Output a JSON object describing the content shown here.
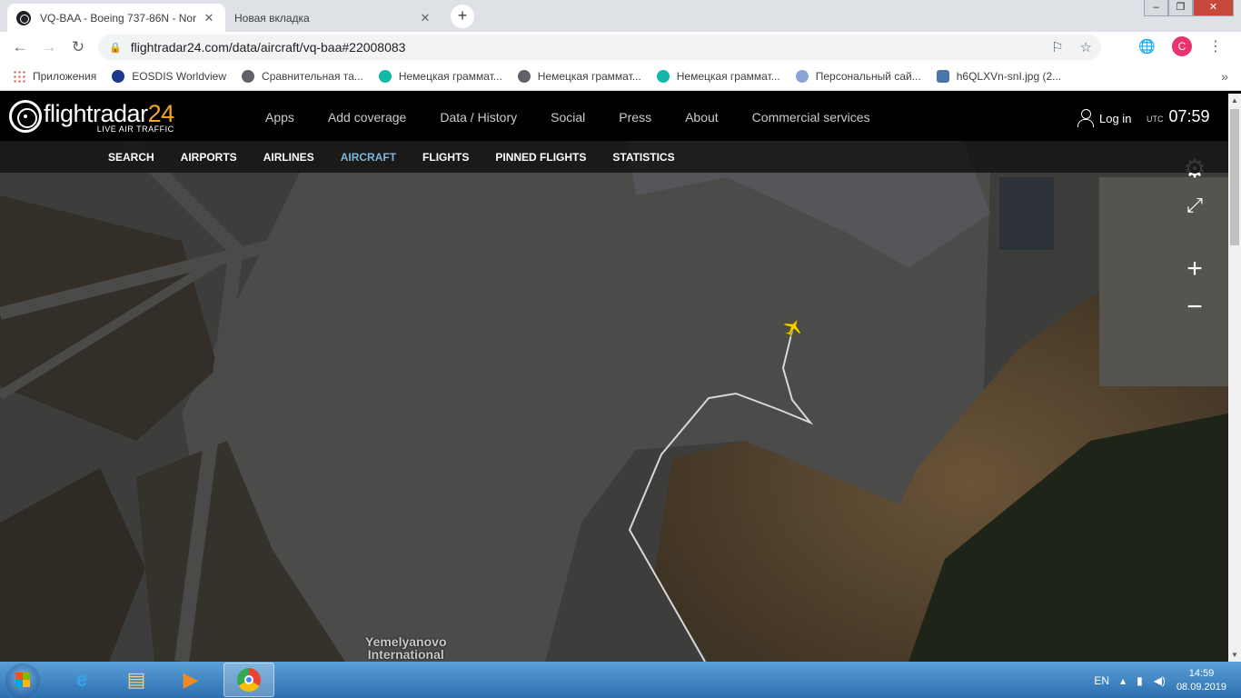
{
  "browser": {
    "tabs": [
      {
        "title": "VQ-BAA - Boeing 737-86N - Nor",
        "close": "✕"
      },
      {
        "title": "Новая вкладка",
        "close": "✕"
      }
    ],
    "new_tab": "+",
    "url": "flightradar24.com/data/aircraft/vq-baa#22008083",
    "profile_initial": "C",
    "bookmarks": [
      {
        "label": "Приложения",
        "icon_color": "apps"
      },
      {
        "label": "EOSDIS Worldview",
        "icon_color": "#1b3a8c"
      },
      {
        "label": "Сравнительная та...",
        "icon_color": "#5f6368"
      },
      {
        "label": "Немецкая граммат...",
        "icon_color": "#14b8a6"
      },
      {
        "label": "Немецкая граммат...",
        "icon_color": "#5f6368"
      },
      {
        "label": "Немецкая граммат...",
        "icon_color": "#14b8a6"
      },
      {
        "label": "Персональный сай...",
        "icon_color": "#8aa4d8"
      },
      {
        "label": "h6QLXVn-snI.jpg (2...",
        "icon_color": "#4a76a8"
      }
    ]
  },
  "fr24": {
    "logo_main": "flightradar",
    "logo_num": "24",
    "logo_sub": "LIVE AIR TRAFFIC",
    "nav": [
      "Apps",
      "Add coverage",
      "Data / History",
      "Social",
      "Press",
      "About",
      "Commercial services"
    ],
    "login": "Log in",
    "utc_label": "UTC",
    "time": "07:59",
    "subnav": [
      "SEARCH",
      "AIRPORTS",
      "AIRLINES",
      "AIRCRAFT",
      "FLIGHTS",
      "PINNED FLIGHTS",
      "STATISTICS"
    ],
    "subnav_active": "AIRCRAFT",
    "map_label_1": "Yemelyanovo",
    "map_label_2": "International",
    "track_color": "#d8d8d8",
    "aircraft_color": "#f5d000"
  },
  "taskbar": {
    "lang": "EN",
    "time": "14:59",
    "date": "08.09.2019"
  }
}
